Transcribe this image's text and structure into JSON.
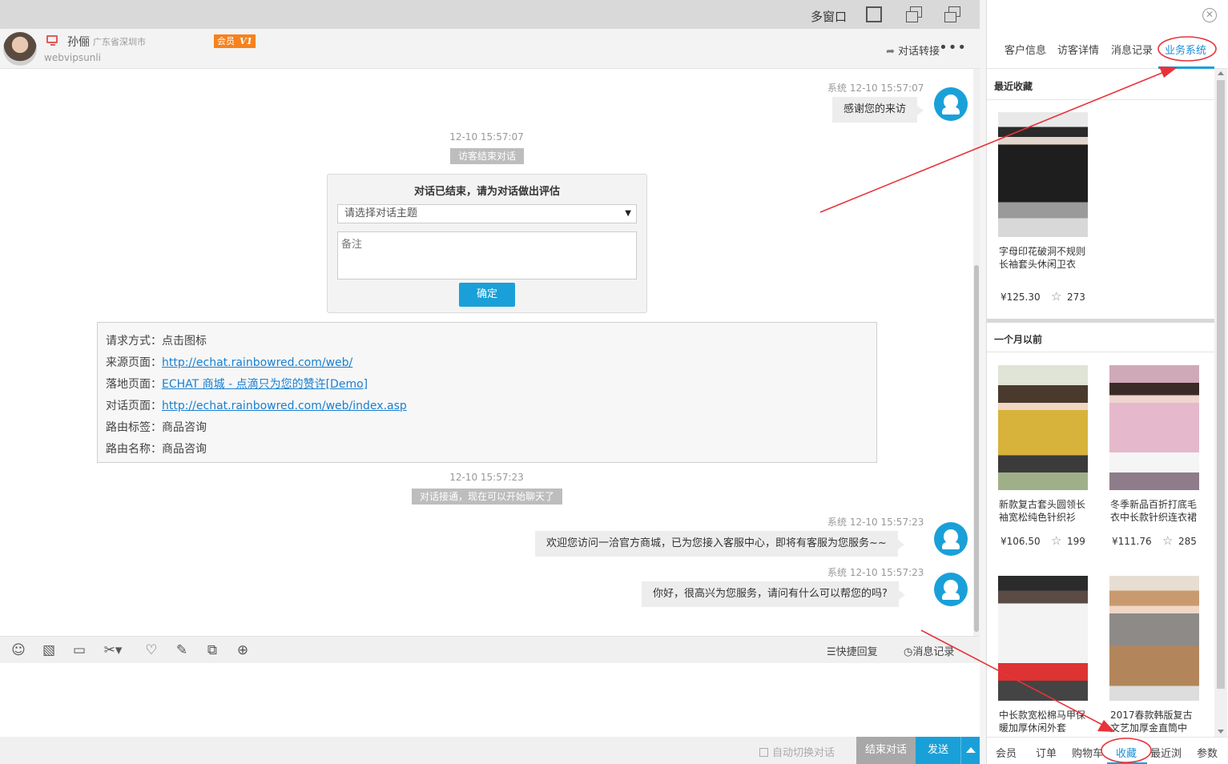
{
  "window": {
    "multi_window_label": "多窗口"
  },
  "visitor": {
    "name": "孙俪",
    "location": "广东省深圳市",
    "member_label": "会员",
    "member_level": "V1",
    "id": "webvipsunli",
    "transfer_label": "对话转接",
    "more_label": "•••"
  },
  "messages": {
    "msg1_meta": "系统  12-10 15:57:07",
    "msg1_text": "感谢您的来访",
    "time1": "12-10 15:57:07",
    "pill1": "访客结束对话",
    "eval": {
      "title": "对话已结束，请为对话做出评估",
      "select_placeholder": "请选择对话主题",
      "note_placeholder": "备注",
      "ok_label": "确定"
    },
    "info": {
      "request_label": "请求方式：",
      "request_value": "点击图标",
      "source_label": "来源页面：",
      "source_url": "http://echat.rainbowred.com/web/",
      "landing_label": "落地页面：",
      "landing_link": "ECHAT 商城 - 点滴只为您的赞许[Demo]",
      "chat_label": "对话页面：",
      "chat_url": "http://echat.rainbowred.com/web/index.asp",
      "route_tag_label": "路由标签：",
      "route_tag_value": "商品咨询",
      "route_name_label": "路由名称：",
      "route_name_value": "商品咨询"
    },
    "time2": "12-10 15:57:23",
    "pill2": "对话接通，现在可以开始聊天了",
    "msg2_meta": "系统  12-10 15:57:23",
    "msg2_text": "欢迎您访问一洽官方商城，已为您接入客服中心，即将有客服为您服务~~",
    "msg3_meta": "系统  12-10 15:57:23",
    "msg3_text": "你好，很高兴为您服务，请问有什么可以帮您的吗?"
  },
  "toolbar": {
    "icons": [
      "smile-icon",
      "image-icon",
      "folder-icon",
      "scissors-icon",
      "heart-icon",
      "edit-icon",
      "link-icon",
      "globe-icon"
    ],
    "quick_reply": "快捷回复",
    "message_record": "消息记录"
  },
  "footer": {
    "auto_switch": "自动切换对话",
    "end_label": "结束对话",
    "send_label": "发送"
  },
  "side": {
    "tabs": [
      "客户信息",
      "访客详情",
      "消息记录",
      "业务系统"
    ],
    "active_tab": "业务系统",
    "recent_title": "最近收藏",
    "month_title": "一个月以前",
    "products": [
      {
        "name": "字母印花破洞不规则长袖套头休闲卫衣",
        "price": "¥125.30",
        "favs": "273"
      },
      {
        "name": "新款复古套头圆领长袖宽松纯色针织衫",
        "price": "¥106.50",
        "favs": "199"
      },
      {
        "name": "冬季新品百折打底毛衣中长款针织连衣裙",
        "price": "¥111.76",
        "favs": "285"
      },
      {
        "name": "中长款宽松棉马甲保暖加厚休闲外套",
        "price": "",
        "favs": ""
      },
      {
        "name": "2017春款韩版复古文艺加厚金直筒中",
        "price": "",
        "favs": ""
      }
    ],
    "bottom_tabs": [
      "会员",
      "订单",
      "购物车",
      "收藏",
      "最近浏",
      "参数"
    ],
    "bottom_active": "收藏"
  },
  "colors": {
    "accent": "#1aa0d8",
    "annotation": "#e8333a",
    "member_badge": "#f5821f"
  }
}
